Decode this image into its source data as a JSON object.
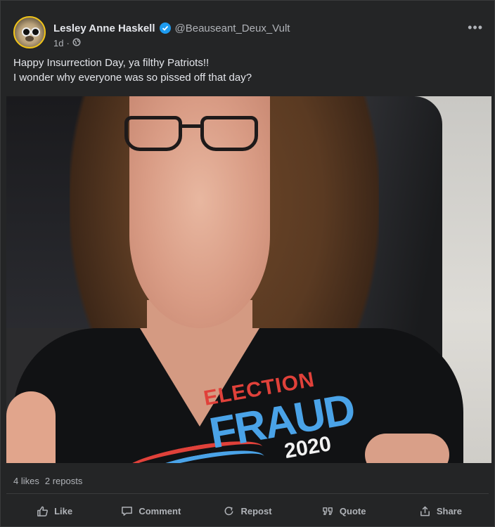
{
  "post": {
    "author": {
      "name": "Lesley Anne Haskell",
      "handle": "@Beauseant_Deux_Vult",
      "verified": true
    },
    "time": "1d",
    "text_lines": [
      "Happy Insurrection Day, ya filthy Patriots!!",
      "I wonder why everyone was so pissed off that day?"
    ],
    "photo_shirt_text": {
      "line1": "ELECTION",
      "line2": "FRAUD",
      "line3": "2020"
    },
    "stats": {
      "likes": "4 likes",
      "reposts": "2 reposts"
    },
    "actions": {
      "like": "Like",
      "comment": "Comment",
      "repost": "Repost",
      "quote": "Quote",
      "share": "Share"
    }
  },
  "colors": {
    "background": "#242526",
    "text": "#e4e6eb",
    "muted": "#b0b3b8",
    "verified": "#1d9bf0"
  },
  "icons": {
    "more": "more-horizontal-icon",
    "visibility": "globe-icon",
    "like": "thumbs-up-icon",
    "comment": "comment-icon",
    "repost": "repost-icon",
    "quote": "quote-icon",
    "share": "share-icon"
  }
}
